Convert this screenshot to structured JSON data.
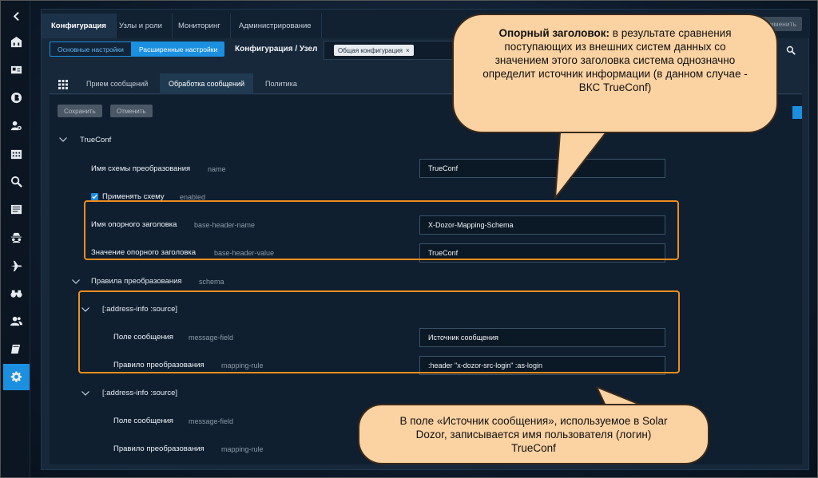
{
  "topnav": {
    "tabs": [
      {
        "label": "Конфигурация",
        "active": true
      },
      {
        "label": "Узлы и роли",
        "active": false
      },
      {
        "label": "Мониторинг",
        "active": false
      },
      {
        "label": "Администрирование",
        "active": false
      }
    ],
    "right_button": "Применить"
  },
  "toolbar": {
    "seg_basic": "Основные настройки",
    "seg_advanced": "Расширенные настройки",
    "breadcrumb": "Конфигурация / Узел",
    "filter_chip": "Общая конфигурация",
    "filter_chip_close": "×"
  },
  "subtabs": [
    {
      "label": "Прием сообщений",
      "active": false
    },
    {
      "label": "Обработка сообщений",
      "active": true
    },
    {
      "label": "Политика",
      "active": false
    }
  ],
  "actions": {
    "save": "Сохранить",
    "cancel": "Отменить"
  },
  "form": {
    "section_title": "TrueConf",
    "schema_name": {
      "label": "Имя схемы преобразования",
      "key": "name",
      "value": "TrueConf"
    },
    "apply_schema": {
      "label": "Применять схему",
      "key": "enabled",
      "checked": true
    },
    "base_header_name": {
      "label": "Имя опорного заголовка",
      "key": "base-header-name",
      "value": "X-Dozor-Mapping-Schema"
    },
    "base_header_value": {
      "label": "Значение опорного заголовка",
      "key": "base-header-value",
      "value": "TrueConf"
    },
    "rules": {
      "label": "Правила преобразования",
      "key": "schema"
    },
    "rule1": {
      "title": "[:address-info :source]",
      "message_field": {
        "label": "Поле сообщения",
        "key": "message-field",
        "value": "Источник сообщения"
      },
      "mapping_rule": {
        "label": "Правило преобразования",
        "key": "mapping-rule",
        "value": ":header \"x-dozor-src-login\" :as-login"
      }
    },
    "rule2": {
      "title": "[:address-info :source]",
      "message_field": {
        "label": "Поле сообщения",
        "key": "message-field"
      },
      "mapping_rule": {
        "label": "Правило преобразования",
        "key": "mapping-rule"
      }
    }
  },
  "callouts": {
    "top_bold": "Опорный заголовок:",
    "top_text": " в результате сравнения поступающих из внешних систем данных со значением этого заголовка система однозначно определит источник информации (в данном случае - ВКС TrueConf)",
    "bottom_text": "В поле «Источник сообщения», используемое в Solar Dozor, записывается имя пользователя (логин) TrueConf"
  },
  "colors": {
    "accent": "#1b8fe0",
    "highlight": "#f08d1e",
    "callout_fill": "#fbd2a2"
  }
}
